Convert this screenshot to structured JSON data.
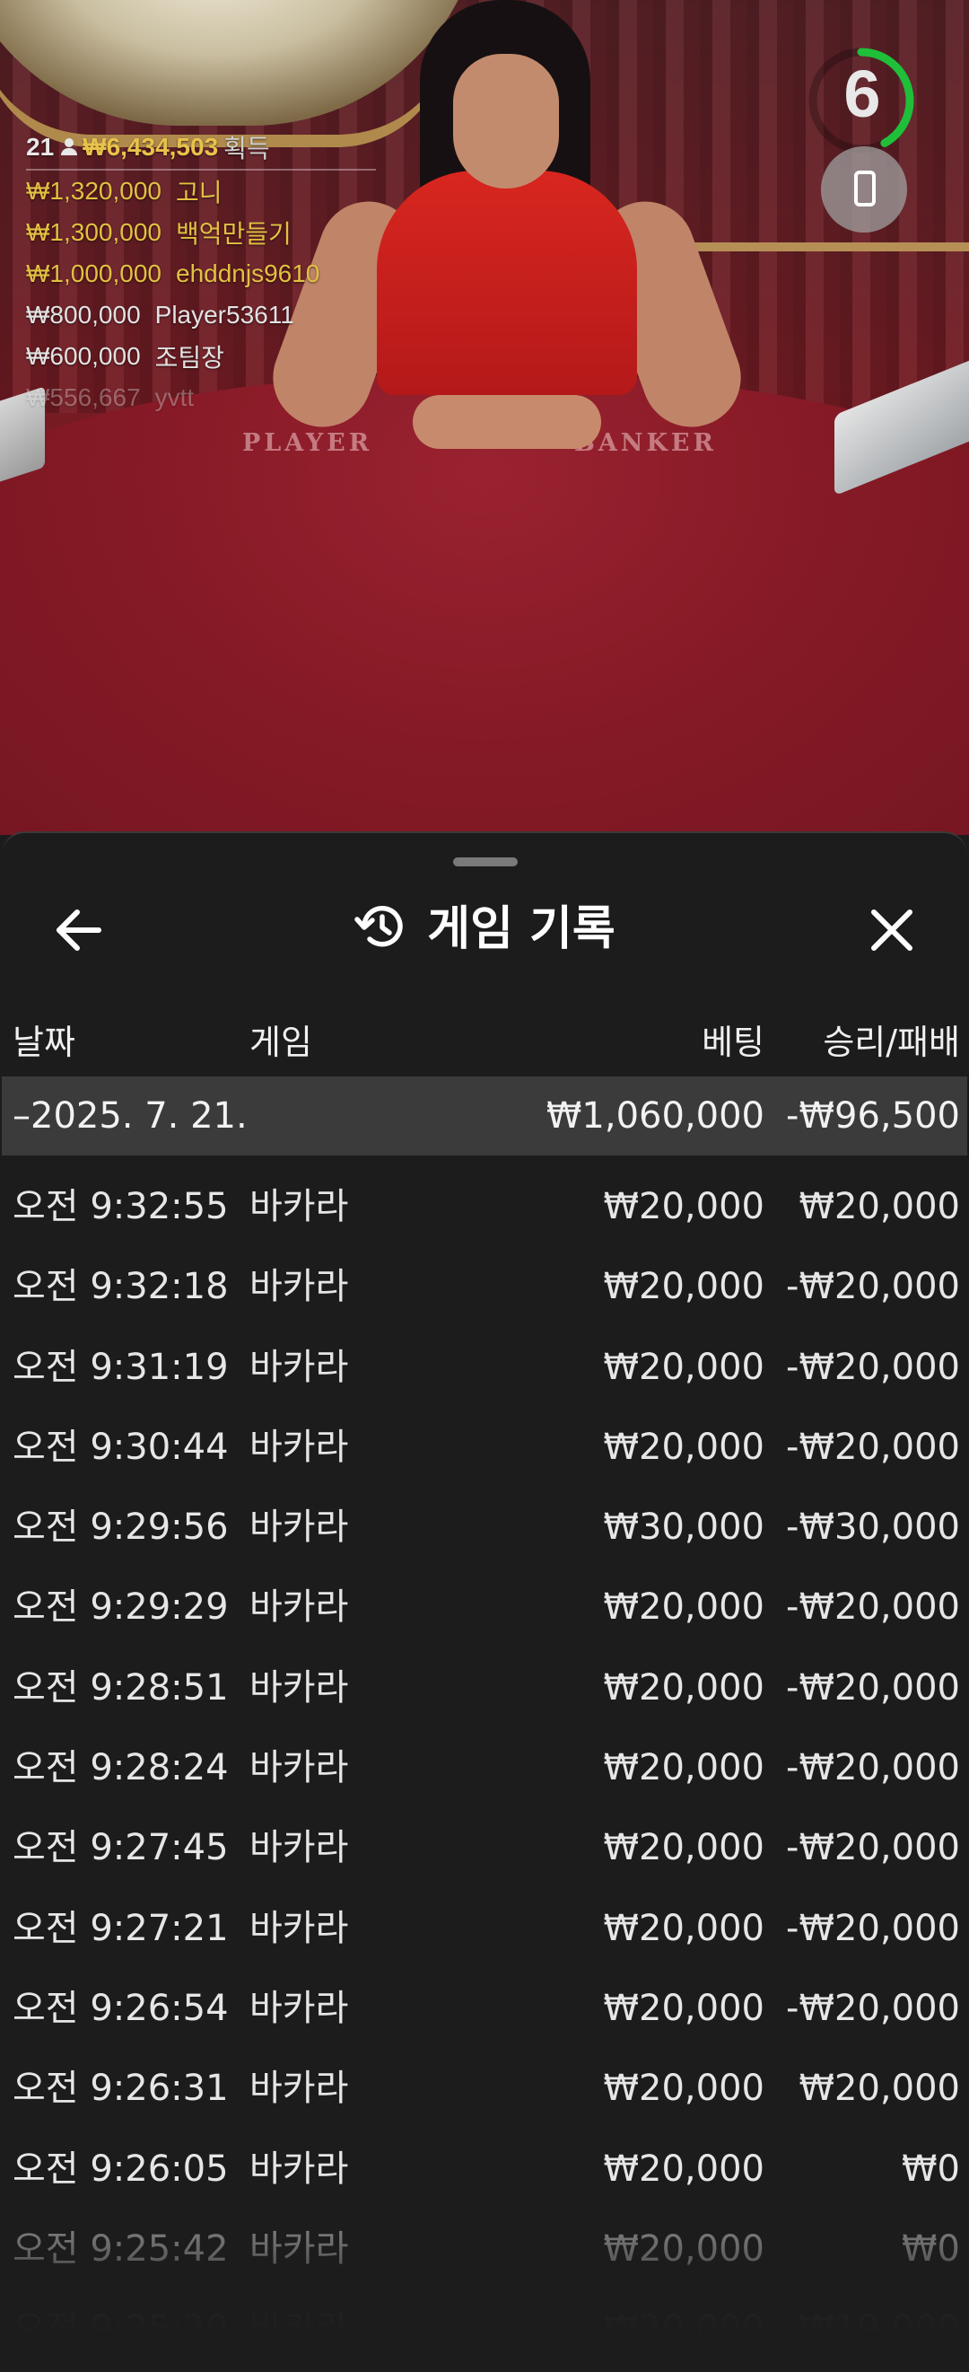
{
  "leaderboard": {
    "count": "21",
    "total": "₩6,434,503",
    "total_label": "획득",
    "entries": [
      {
        "amount": "₩1,320,000",
        "name": "고니",
        "tier": "gold"
      },
      {
        "amount": "₩1,300,000",
        "name": "백억만들기",
        "tier": "gold"
      },
      {
        "amount": "₩1,000,000",
        "name": "ehddnjs9610",
        "tier": "gold"
      },
      {
        "amount": "₩800,000",
        "name": "Player53611",
        "tier": "silver"
      },
      {
        "amount": "₩600,000",
        "name": "조팀장",
        "tier": "silver"
      },
      {
        "amount": "₩556,667",
        "name": "yvtt",
        "tier": "fade"
      }
    ]
  },
  "table_labels": {
    "left": "PLAYER",
    "right": "BANKER"
  },
  "timer": {
    "value": "6",
    "progress": 0.42,
    "color": "#1fbf3a"
  },
  "panel": {
    "title": "게임 기록",
    "title_icon": "history-icon",
    "back_icon": "arrow-left-icon",
    "close_icon": "close-icon",
    "columns": {
      "date": "날짜",
      "game": "게임",
      "bet": "베팅",
      "result": "승리/패배"
    },
    "date_group": {
      "date": "–2025. 7. 21.",
      "bet_total": "₩1,060,000",
      "result_total": "-₩96,500"
    },
    "rows": [
      {
        "time": "오전 9:32:55",
        "game": "바카라",
        "bet": "₩20,000",
        "result": "₩20,000"
      },
      {
        "time": "오전 9:32:18",
        "game": "바카라",
        "bet": "₩20,000",
        "result": "-₩20,000"
      },
      {
        "time": "오전 9:31:19",
        "game": "바카라",
        "bet": "₩20,000",
        "result": "-₩20,000"
      },
      {
        "time": "오전 9:30:44",
        "game": "바카라",
        "bet": "₩20,000",
        "result": "-₩20,000"
      },
      {
        "time": "오전 9:29:56",
        "game": "바카라",
        "bet": "₩30,000",
        "result": "-₩30,000"
      },
      {
        "time": "오전 9:29:29",
        "game": "바카라",
        "bet": "₩20,000",
        "result": "-₩20,000"
      },
      {
        "time": "오전 9:28:51",
        "game": "바카라",
        "bet": "₩20,000",
        "result": "-₩20,000"
      },
      {
        "time": "오전 9:28:24",
        "game": "바카라",
        "bet": "₩20,000",
        "result": "-₩20,000"
      },
      {
        "time": "오전 9:27:45",
        "game": "바카라",
        "bet": "₩20,000",
        "result": "-₩20,000"
      },
      {
        "time": "오전 9:27:21",
        "game": "바카라",
        "bet": "₩20,000",
        "result": "-₩20,000"
      },
      {
        "time": "오전 9:26:54",
        "game": "바카라",
        "bet": "₩20,000",
        "result": "-₩20,000"
      },
      {
        "time": "오전 9:26:31",
        "game": "바카라",
        "bet": "₩20,000",
        "result": "₩20,000"
      },
      {
        "time": "오전 9:26:05",
        "game": "바카라",
        "bet": "₩20,000",
        "result": "₩0"
      },
      {
        "time": "오전 9:25:42",
        "game": "바카라",
        "bet": "₩20,000",
        "result": "₩0"
      },
      {
        "time": "오전 9:25:20",
        "game": "바카라",
        "bet": "₩20,000",
        "result": "₩19,000"
      }
    ]
  }
}
